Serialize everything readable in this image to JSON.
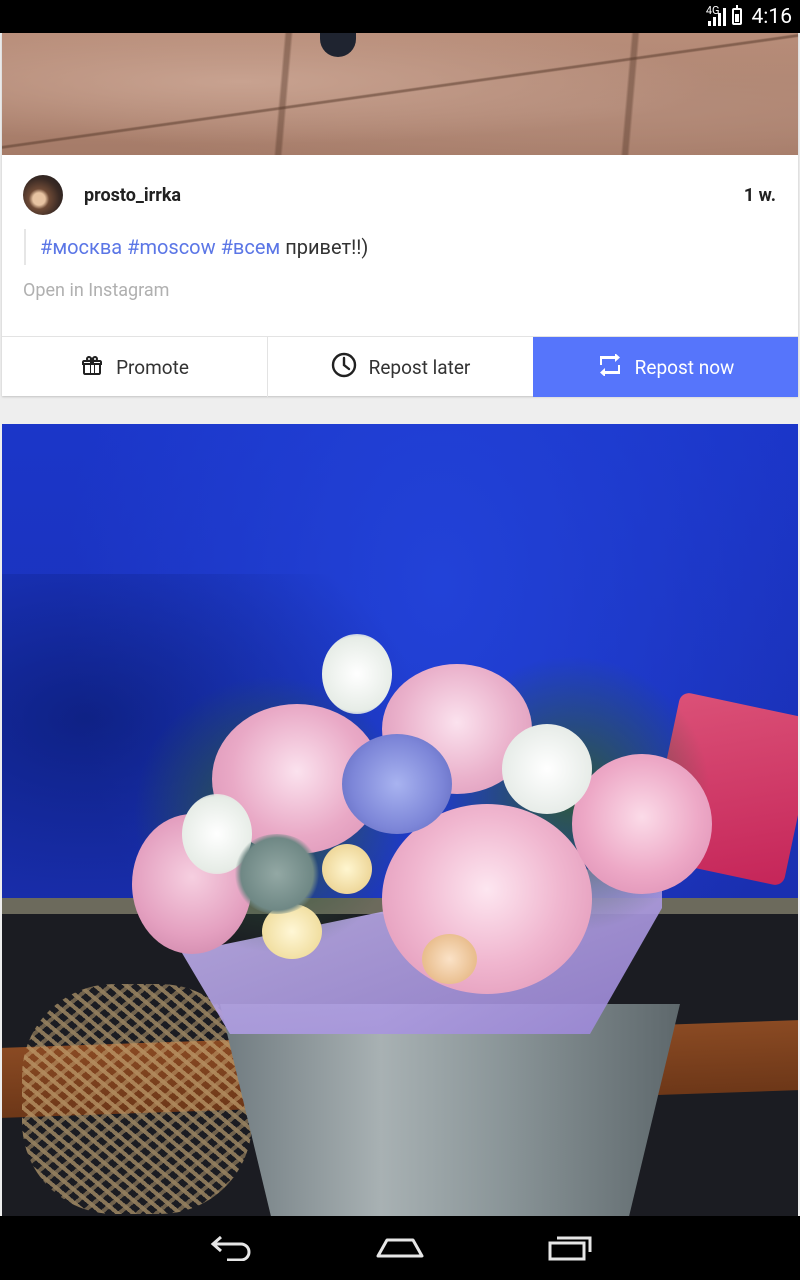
{
  "status_bar": {
    "network": "4G",
    "time": "4:16"
  },
  "post": {
    "username": "prosto_irrka",
    "age": "1 w.",
    "caption": {
      "tags": [
        "#москва",
        "#moscow",
        "#всем"
      ],
      "text": "привет!!)"
    },
    "open_link": "Open in Instagram"
  },
  "actions": {
    "promote": "Promote",
    "repost_later": "Repost later",
    "repost_now": "Repost now"
  },
  "colors": {
    "accent": "#5675fb",
    "hashtag": "#5b76e6"
  },
  "nav_bar": {
    "icons": [
      "back-icon",
      "home-icon",
      "recents-icon"
    ]
  }
}
